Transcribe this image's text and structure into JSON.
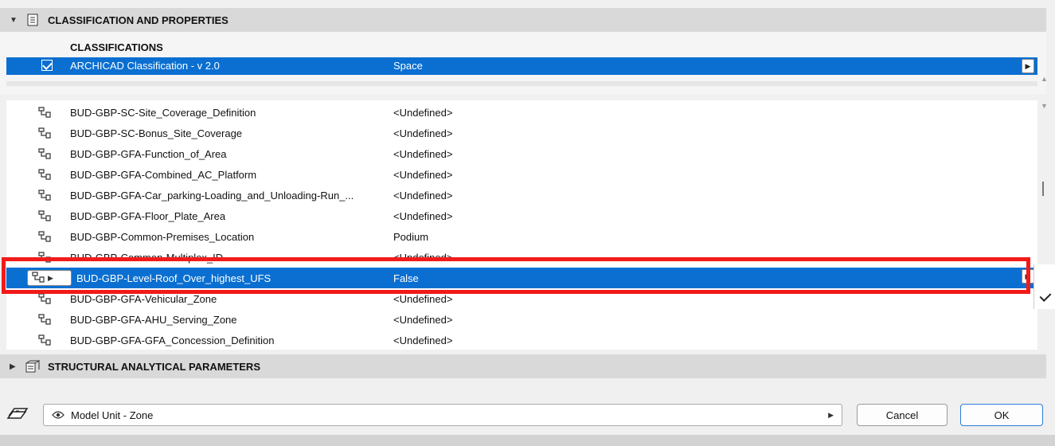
{
  "classification_section": {
    "title": "CLASSIFICATION AND PROPERTIES",
    "classifications_label": "CLASSIFICATIONS",
    "row": {
      "name": "ARCHICAD Classification - v 2.0",
      "value": "Space",
      "checked": true
    }
  },
  "properties": [
    {
      "name": "BUD-GBP-SC-Site_Coverage_Definition",
      "value": "<Undefined>"
    },
    {
      "name": "BUD-GBP-SC-Bonus_Site_Coverage",
      "value": "<Undefined>"
    },
    {
      "name": "BUD-GBP-GFA-Function_of_Area",
      "value": "<Undefined>"
    },
    {
      "name": "BUD-GBP-GFA-Combined_AC_Platform",
      "value": "<Undefined>"
    },
    {
      "name": "BUD-GBP-GFA-Car_parking-Loading_and_Unloading-Run_...",
      "value": "<Undefined>"
    },
    {
      "name": "BUD-GBP-GFA-Floor_Plate_Area",
      "value": "<Undefined>"
    },
    {
      "name": "BUD-GBP-Common-Premises_Location",
      "value": "Podium"
    },
    {
      "name": "BUD-GBP-Common-Multiplex_ID",
      "value": "<Undefined>"
    },
    {
      "name": "BUD-GBP-Level-Roof_Over_highest_UFS",
      "value": "False",
      "selected": true
    },
    {
      "name": "BUD-GBP-GFA-Vehicular_Zone",
      "value": "<Undefined>"
    },
    {
      "name": "BUD-GBP-GFA-AHU_Serving_Zone",
      "value": "<Undefined>"
    },
    {
      "name": "BUD-GBP-GFA-GFA_Concession_Definition",
      "value": "<Undefined>"
    }
  ],
  "structural_section": {
    "title": "STRUCTURAL ANALYTICAL PARAMETERS"
  },
  "bottom": {
    "view_dropdown": "Model Unit - Zone",
    "cancel_label": "Cancel",
    "ok_label": "OK"
  },
  "colors": {
    "selection": "#0a6fd1",
    "highlight_box": "#f21a1a",
    "header": "#d9d9d9"
  },
  "icons": [
    "chevron-down-icon",
    "document-icon",
    "checkbox-icon",
    "property-icon",
    "chevron-right-icon",
    "structural-icon",
    "layers-icon",
    "eye-icon"
  ]
}
